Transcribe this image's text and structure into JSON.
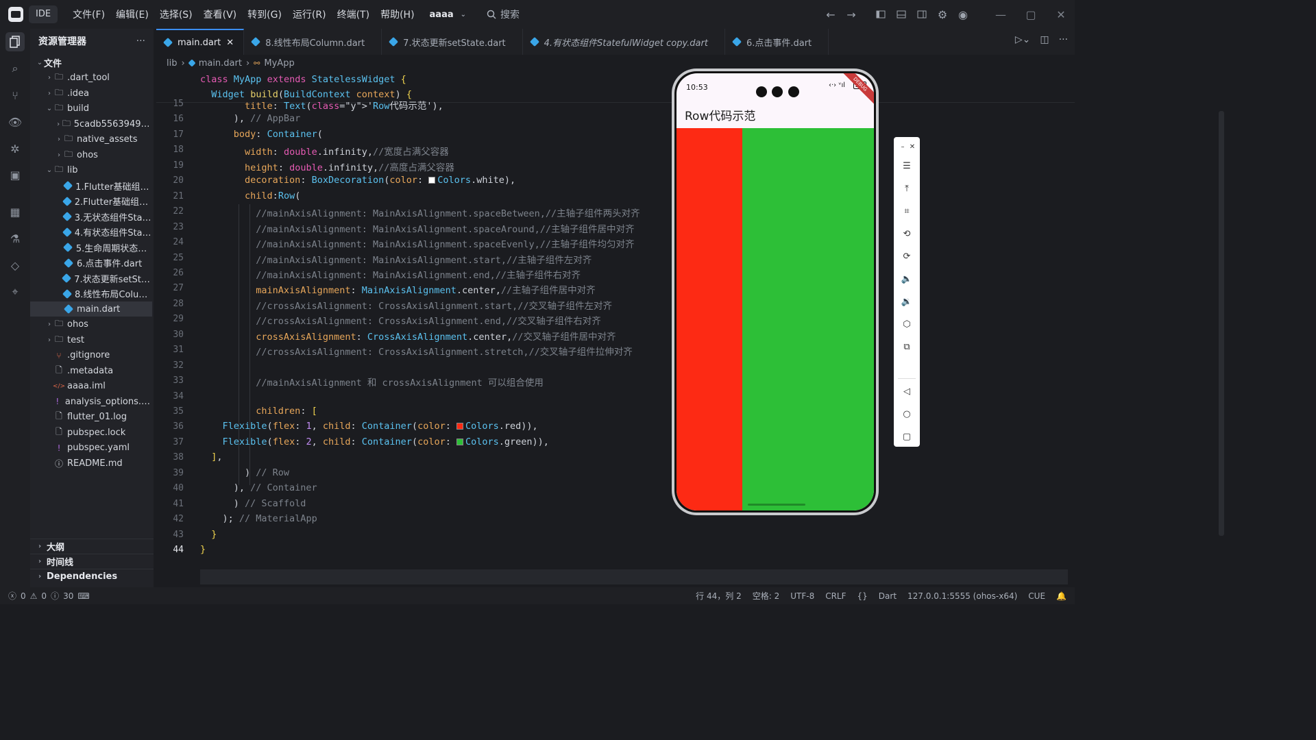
{
  "titlebar": {
    "app_badge": "IDE",
    "menu": [
      "文件(F)",
      "编辑(E)",
      "选择(S)",
      "查看(V)",
      "转到(G)",
      "运行(R)",
      "终端(T)",
      "帮助(H)"
    ],
    "project": "aaaa",
    "search_label": "搜索"
  },
  "sidebar": {
    "title": "资源管理器",
    "more": "···",
    "tree": [
      {
        "label": "文件",
        "indent": 0,
        "kind": "section",
        "expanded": true
      },
      {
        "label": ".dart_tool",
        "indent": 1,
        "kind": "folder",
        "expanded": false
      },
      {
        "label": ".idea",
        "indent": 1,
        "kind": "folder",
        "expanded": false
      },
      {
        "label": "build",
        "indent": 1,
        "kind": "folder",
        "expanded": true
      },
      {
        "label": "5cadb5563949439...",
        "indent": 2,
        "kind": "folder",
        "expanded": false
      },
      {
        "label": "native_assets",
        "indent": 2,
        "kind": "folder",
        "expanded": false
      },
      {
        "label": "ohos",
        "indent": 2,
        "kind": "folder",
        "expanded": false
      },
      {
        "label": "lib",
        "indent": 1,
        "kind": "folder",
        "expanded": true
      },
      {
        "label": "1.Flutter基础组件...",
        "indent": 2,
        "kind": "dart"
      },
      {
        "label": "2.Flutter基础组件S...",
        "indent": 2,
        "kind": "dart"
      },
      {
        "label": "3.无状态组件Statel...",
        "indent": 2,
        "kind": "dart"
      },
      {
        "label": "4.有状态组件Statef...",
        "indent": 2,
        "kind": "dart"
      },
      {
        "label": "5.生命周期状态组...",
        "indent": 2,
        "kind": "dart"
      },
      {
        "label": "6.点击事件.dart",
        "indent": 2,
        "kind": "dart"
      },
      {
        "label": "7.状态更新setState...",
        "indent": 2,
        "kind": "dart"
      },
      {
        "label": "8.线性布局Column...",
        "indent": 2,
        "kind": "dart"
      },
      {
        "label": "main.dart",
        "indent": 2,
        "kind": "dart",
        "selected": true
      },
      {
        "label": "ohos",
        "indent": 1,
        "kind": "folder",
        "expanded": false
      },
      {
        "label": "test",
        "indent": 1,
        "kind": "folder",
        "expanded": false
      },
      {
        "label": ".gitignore",
        "indent": 1,
        "kind": "git"
      },
      {
        "label": ".metadata",
        "indent": 1,
        "kind": "file"
      },
      {
        "label": "aaaa.iml",
        "indent": 1,
        "kind": "xml"
      },
      {
        "label": "analysis_options.yaml",
        "indent": 1,
        "kind": "yaml"
      },
      {
        "label": "flutter_01.log",
        "indent": 1,
        "kind": "file"
      },
      {
        "label": "pubspec.lock",
        "indent": 1,
        "kind": "file"
      },
      {
        "label": "pubspec.yaml",
        "indent": 1,
        "kind": "yaml"
      },
      {
        "label": "README.md",
        "indent": 1,
        "kind": "info"
      }
    ],
    "bottom_sections": [
      "大纲",
      "时间线",
      "Dependencies"
    ]
  },
  "tabs": [
    {
      "label": "main.dart",
      "active": true,
      "italic": false
    },
    {
      "label": "8.线性布局Column.dart",
      "active": false,
      "italic": false
    },
    {
      "label": "7.状态更新setState.dart",
      "active": false,
      "italic": false
    },
    {
      "label": "4.有状态组件StatefulWidget copy.dart",
      "active": false,
      "italic": true
    },
    {
      "label": "6.点击事件.dart",
      "active": false,
      "italic": false
    }
  ],
  "breadcrumb": [
    "lib",
    "main.dart",
    "MyApp"
  ],
  "sticky": [
    "class MyApp extends StatelessWidget {",
    "  Widget build(BuildContext context) {"
  ],
  "code": [
    {
      "n": "15",
      "text": "        title: Text('Row代码示范'),"
    },
    {
      "n": "16",
      "text": "      ), // AppBar"
    },
    {
      "n": "17",
      "text": "      body: Container("
    },
    {
      "n": "18",
      "text": "        width: double.infinity,//宽度占满父容器"
    },
    {
      "n": "19",
      "text": "        height: double.infinity,//高度占满父容器"
    },
    {
      "n": "20",
      "text": "        decoration: BoxDecoration(color: Colors.white),"
    },
    {
      "n": "21",
      "text": "        child:Row("
    },
    {
      "n": "22",
      "text": "          //mainAxisAlignment: MainAxisAlignment.spaceBetween,//主轴子组件两头对齐"
    },
    {
      "n": "23",
      "text": "          //mainAxisAlignment: MainAxisAlignment.spaceAround,//主轴子组件居中对齐"
    },
    {
      "n": "24",
      "text": "          //mainAxisAlignment: MainAxisAlignment.spaceEvenly,//主轴子组件均匀对齐"
    },
    {
      "n": "25",
      "text": "          //mainAxisAlignment: MainAxisAlignment.start,//主轴子组件左对齐"
    },
    {
      "n": "26",
      "text": "          //mainAxisAlignment: MainAxisAlignment.end,//主轴子组件右对齐"
    },
    {
      "n": "27",
      "text": "          mainAxisAlignment: MainAxisAlignment.center,//主轴子组件居中对齐"
    },
    {
      "n": "28",
      "text": "          //crossAxisAlignment: CrossAxisAlignment.start,//交叉轴子组件左对齐"
    },
    {
      "n": "29",
      "text": "          //crossAxisAlignment: CrossAxisAlignment.end,//交叉轴子组件右对齐"
    },
    {
      "n": "30",
      "text": "          crossAxisAlignment: CrossAxisAlignment.center,//交叉轴子组件居中对齐"
    },
    {
      "n": "31",
      "text": "          //crossAxisAlignment: CrossAxisAlignment.stretch,//交叉轴子组件拉伸对齐"
    },
    {
      "n": "32",
      "text": ""
    },
    {
      "n": "33",
      "text": "          //mainAxisAlignment 和 crossAxisAlignment 可以组合使用"
    },
    {
      "n": "34",
      "text": ""
    },
    {
      "n": "35",
      "text": "          children: ["
    },
    {
      "n": "36",
      "text": "    Flexible(flex: 1, child: Container(color: Colors.red)),"
    },
    {
      "n": "37",
      "text": "    Flexible(flex: 2, child: Container(color: Colors.green)),"
    },
    {
      "n": "38",
      "text": "  ],"
    },
    {
      "n": "39",
      "text": "        ) // Row"
    },
    {
      "n": "40",
      "text": "      ), // Container"
    },
    {
      "n": "41",
      "text": "      ) // Scaffold"
    },
    {
      "n": "42",
      "text": "    ); // MaterialApp"
    },
    {
      "n": "43",
      "text": "  }"
    },
    {
      "n": "44",
      "text": "}"
    }
  ],
  "phone": {
    "time": "10:53",
    "battery": "100",
    "debug_banner": "DEBUG",
    "appbar_title": "Row代码示范",
    "body_colors": {
      "red": "#fd2a14",
      "green": "#2dbf37"
    },
    "flex": [
      1,
      2
    ]
  },
  "statusbar": {
    "errors": "0",
    "warnings": "0",
    "infos": "30",
    "position": "行 44，列 2",
    "spaces": "空格: 2",
    "encoding": "UTF-8",
    "eol": "CRLF",
    "language": "Dart",
    "device": "127.0.0.1:5555 (ohos-x64)",
    "cue": "CUE"
  },
  "colors": {
    "accent": "#3b8ef0",
    "keyword": "#e65bb4",
    "type": "#5bc2f0",
    "func": "#e8d16a",
    "prop": "#e8a75a",
    "comment": "#7d838c"
  }
}
